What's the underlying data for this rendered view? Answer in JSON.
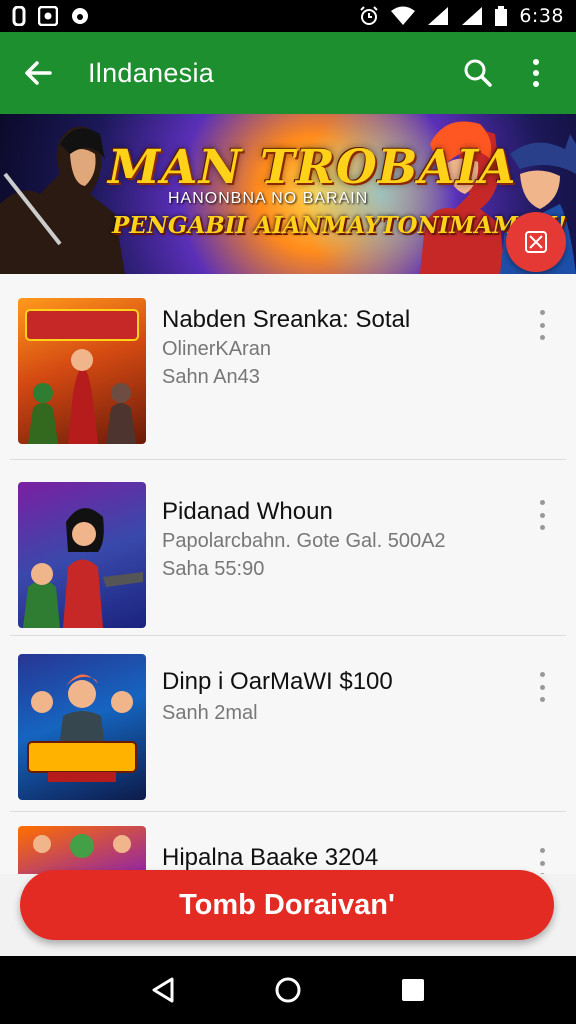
{
  "status_bar": {
    "time": "6:38",
    "icons": [
      "notification-icon",
      "image-icon",
      "dot-icon",
      "alarm-icon",
      "wifi-icon",
      "signal-icon",
      "signal-icon",
      "battery-icon"
    ]
  },
  "app_bar": {
    "title": "Ilndanesia",
    "back_icon": "arrow-left-icon",
    "search_icon": "search-icon",
    "overflow_icon": "more-vertical-icon",
    "color": "#1e8f2f"
  },
  "banner": {
    "title": "MAN TROBAIA",
    "subtitle": "HANONBNA NO BARAIN",
    "tagline": "PENGABII AIANMAYTONIMAMEN!",
    "fab_icon": "close-box-icon",
    "fab_color": "#e53935"
  },
  "items": [
    {
      "title": "Nabden Sreanka: Sotal",
      "line1": "OlinerKAran",
      "line2": "Sahn An43"
    },
    {
      "title": "Pidanad Whoun",
      "line1": "Papolarcbahn. Gote Gal. 500A2",
      "line2": "Saha 55:90"
    },
    {
      "title": "Dinp i OarMaWI $100",
      "line1": "Sanh 2mal",
      "line2": ""
    },
    {
      "title": "Hipalna Baake 3204",
      "line1": "",
      "line2": ""
    }
  ],
  "cta": {
    "label": "Tomb Doraivan'",
    "color": "#e32b23"
  },
  "nav": {
    "back": "triangle-back-icon",
    "home": "circle-home-icon",
    "recents": "square-recents-icon"
  }
}
